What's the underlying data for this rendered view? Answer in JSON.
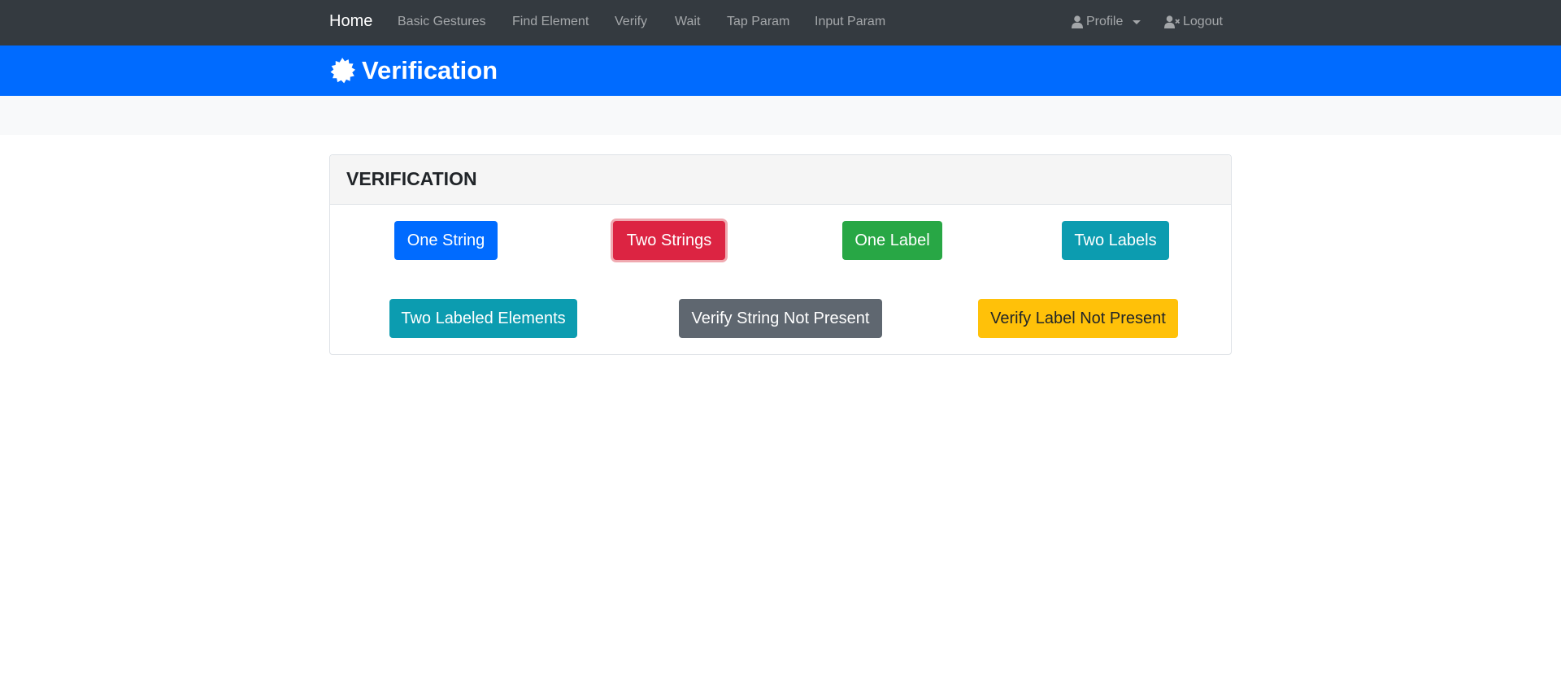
{
  "navbar": {
    "brand": "Home",
    "links": [
      "Basic Gestures",
      "Find Element",
      "Verify",
      "Wait",
      "Tap Param",
      "Input Param"
    ],
    "profile_label": "Profile",
    "logout_label": "Logout"
  },
  "header": {
    "title": "Verification",
    "icon": "certificate-icon"
  },
  "card": {
    "title": "VERIFICATION",
    "buttons_row1": [
      "One String",
      "Two Strings",
      "One Label",
      "Two Labels"
    ],
    "buttons_row2": [
      "Two Labeled Elements",
      "Verify String Not Present",
      "Verify Label Not Present"
    ]
  },
  "colors": {
    "navbar": "#343a40",
    "header": "#006bff",
    "primary": "#006bff",
    "danger": "#dc2442",
    "success": "#28a745",
    "info": "#0c9cb0",
    "secondary": "#5f6770",
    "warning": "#ffc109"
  }
}
